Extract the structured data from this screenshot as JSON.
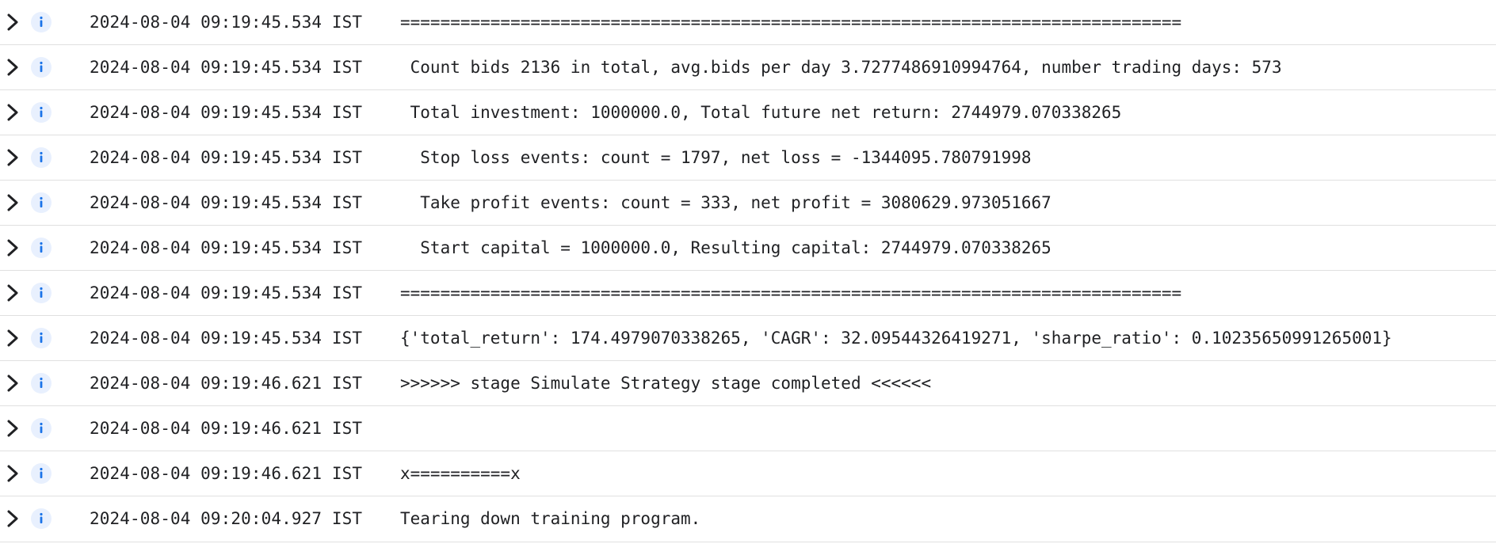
{
  "log": {
    "entries": [
      {
        "timestamp": "2024-08-04 09:19:45.534 IST",
        "severity": "info-icon",
        "message": "=============================================================================="
      },
      {
        "timestamp": "2024-08-04 09:19:45.534 IST",
        "severity": "info-icon",
        "message": " Count bids 2136 in total, avg.bids per day 3.7277486910994764, number trading days: 573"
      },
      {
        "timestamp": "2024-08-04 09:19:45.534 IST",
        "severity": "info-icon",
        "message": " Total investment: 1000000.0, Total future net return: 2744979.070338265"
      },
      {
        "timestamp": "2024-08-04 09:19:45.534 IST",
        "severity": "info-icon",
        "message": "  Stop loss events: count = 1797, net loss = -1344095.780791998"
      },
      {
        "timestamp": "2024-08-04 09:19:45.534 IST",
        "severity": "info-icon",
        "message": "  Take profit events: count = 333, net profit = 3080629.973051667"
      },
      {
        "timestamp": "2024-08-04 09:19:45.534 IST",
        "severity": "info-icon",
        "message": "  Start capital = 1000000.0, Resulting capital: 2744979.070338265"
      },
      {
        "timestamp": "2024-08-04 09:19:45.534 IST",
        "severity": "info-icon",
        "message": "=============================================================================="
      },
      {
        "timestamp": "2024-08-04 09:19:45.534 IST",
        "severity": "info-icon",
        "message": "{'total_return': 174.4979070338265, 'CAGR': 32.09544326419271, 'sharpe_ratio': 0.10235650991265001}"
      },
      {
        "timestamp": "2024-08-04 09:19:46.621 IST",
        "severity": "info-icon",
        "message": ">>>>>> stage Simulate Strategy stage completed <<<<<<"
      },
      {
        "timestamp": "2024-08-04 09:19:46.621 IST",
        "severity": "info-icon",
        "message": ""
      },
      {
        "timestamp": "2024-08-04 09:19:46.621 IST",
        "severity": "info-icon",
        "message": "x==========x"
      },
      {
        "timestamp": "2024-08-04 09:20:04.927 IST",
        "severity": "info-icon",
        "message": "Tearing down training program."
      }
    ]
  },
  "colors": {
    "info_icon_bg": "#e8f0fe",
    "info_icon_fg": "#1a73e8",
    "chevron": "#202124",
    "divider": "#e0e0e0",
    "text": "#202124"
  }
}
